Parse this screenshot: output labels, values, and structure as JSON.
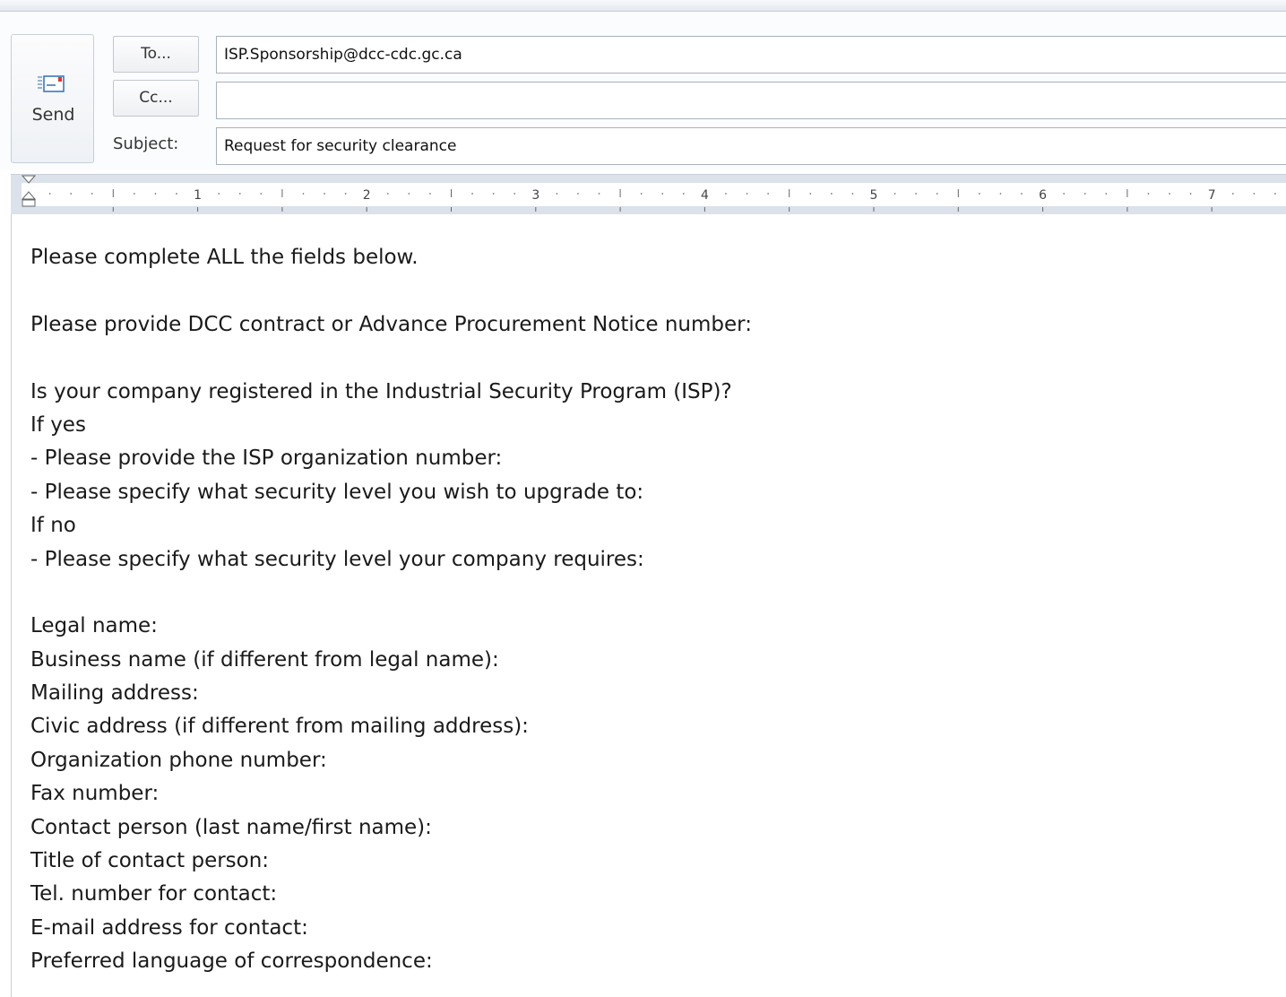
{
  "compose": {
    "send_label": "Send",
    "to_button": "To...",
    "cc_button": "Cc...",
    "subject_label": "Subject:",
    "to_value": "ISP.Sponsorship@dcc-cdc.gc.ca",
    "cc_value": "",
    "subject_value": "Request for security clearance"
  },
  "ruler": {
    "numbers": [
      "1",
      "2",
      "3",
      "4",
      "5",
      "6",
      "7"
    ]
  },
  "body": {
    "lines": [
      "Please complete ALL the fields below.",
      "",
      "Please provide DCC contract or Advance Procurement Notice number:",
      "",
      "Is your company registered in the Industrial Security Program (ISP)?",
      "If yes",
      "- Please provide the ISP organization number:",
      "- Please specify what security level you wish to upgrade to:",
      "If no",
      "- Please specify what security level your company requires:",
      "",
      "Legal name:",
      "Business name (if different from legal name):",
      "Mailing address:",
      "Civic address (if different from mailing address):",
      "Organization phone number:",
      "Fax number:",
      "Contact person (last name/first name):",
      "Title of contact person:",
      "Tel. number for contact:",
      "E-mail address for contact:",
      "Preferred language of correspondence:"
    ]
  },
  "icons": {
    "send": "envelope-send-icon"
  },
  "colors": {
    "ruler_bg": "#dbe2ec",
    "field_border": "#a9b1bb",
    "send_accent": "#e8302b",
    "send_blue": "#2f6fbf"
  }
}
